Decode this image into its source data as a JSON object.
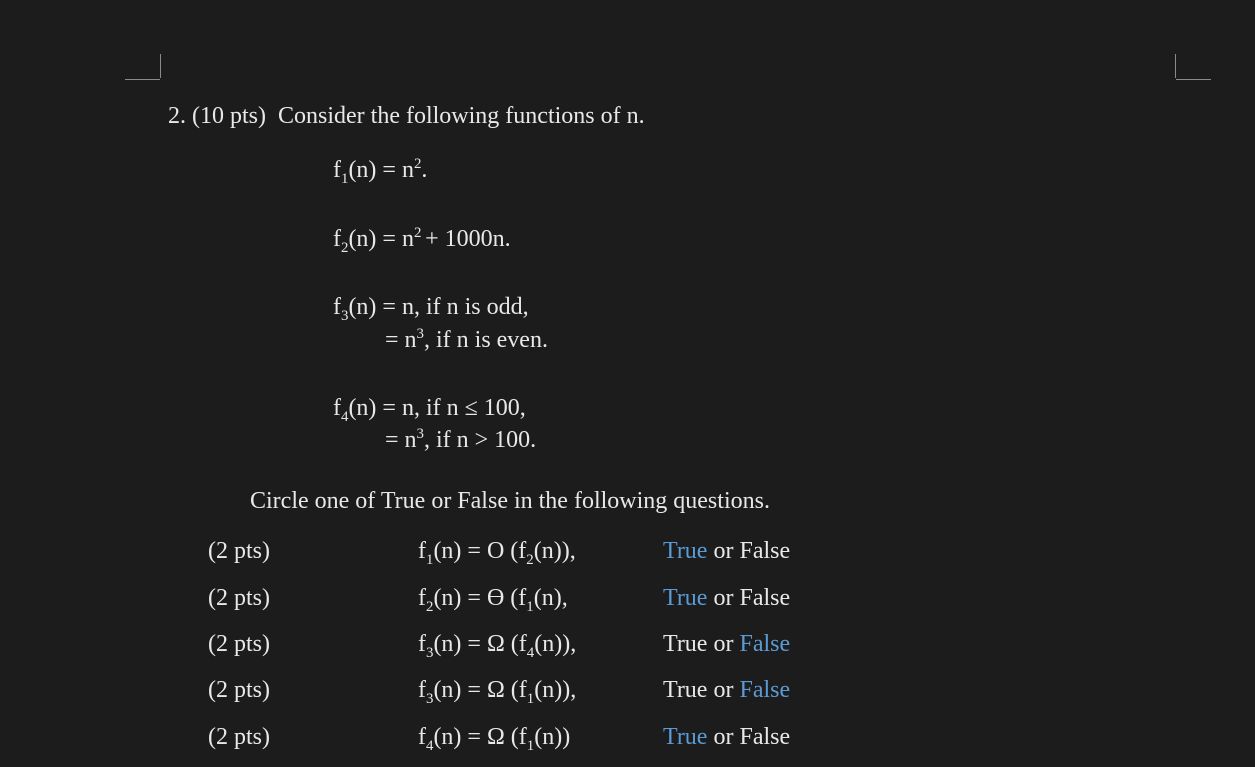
{
  "question": {
    "number": "2.",
    "points": "(10 pts)",
    "prompt": "Consider the following functions of n."
  },
  "defs": {
    "f1": "f₁(n) = n².",
    "f2": "f₂(n) = n² + 1000n.",
    "f3a": "f₃(n) = n, if n is odd,",
    "f3b": "= n³, if n is even.",
    "f4a": "f₄(n) = n, if n ≤ 100,",
    "f4b": "= n³, if n > 100."
  },
  "instruction": "Circle one of True or False in the following questions.",
  "rows": [
    {
      "pts": "(2 pts)",
      "expr": "f₁(n) = O (f₂(n)),",
      "true": "True",
      "mid": " or ",
      "false": "False",
      "answer": "true"
    },
    {
      "pts": "(2 pts)",
      "expr": "f₂(n) = ϴ (f₁(n),",
      "true": "True",
      "mid": " or ",
      "false": "False",
      "answer": "true"
    },
    {
      "pts": "(2 pts)",
      "expr": "f₃(n) = Ω (f₄(n)),",
      "true": "True",
      "mid": " or ",
      "false": "False",
      "answer": "false"
    },
    {
      "pts": "(2 pts)",
      "expr": "f₃(n) = Ω (f₁(n)),",
      "true": "True",
      "mid": " or ",
      "false": "False",
      "answer": "false"
    },
    {
      "pts": "(2 pts)",
      "expr": "f₄(n) = Ω (f₁(n))",
      "true": "True",
      "mid": " or ",
      "false": "False",
      "answer": "true"
    }
  ]
}
